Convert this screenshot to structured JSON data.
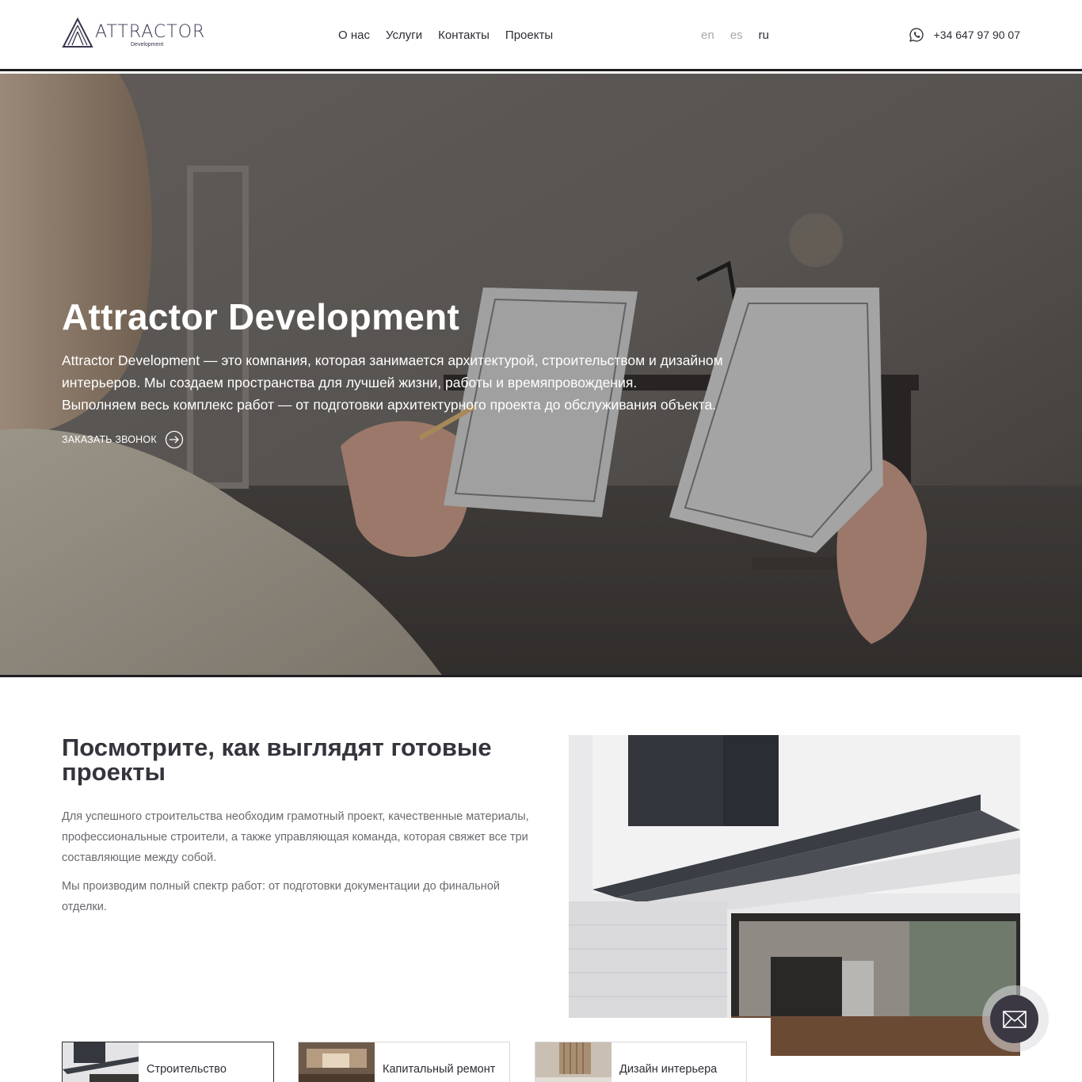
{
  "header": {
    "logo_text": "ATTRACTOR",
    "logo_sub": "Development",
    "nav": [
      "О нас",
      "Услуги",
      "Контакты",
      "Проекты"
    ],
    "langs": [
      {
        "code": "en",
        "active": false
      },
      {
        "code": "es",
        "active": false
      },
      {
        "code": "ru",
        "active": true
      }
    ],
    "phone": "+34 647 97 90 07",
    "phone_icon": "whatsapp-icon"
  },
  "hero": {
    "title": "Attractor Development",
    "lines": [
      "Attractor Development — это компания, которая занимается архитектурой, строительством и дизайном",
      "интерьеров. Мы создаем пространства для лучшей жизни, работы и времяпровождения.",
      "Выполняем весь комплекс работ — от подготовки архитектурного проекта до обслуживания объекта."
    ],
    "cta": "Заказать звонок",
    "cta_icon": "arrow-right-circle-icon"
  },
  "projects": {
    "title": "Посмотрите, как выглядят готовые проекты",
    "p1": "Для успешного строительства необходим грамотный проект, качественные материалы, профессиональные строители, а также управляющая команда, которая свяжет все три составляющие между собой.",
    "p2": "Мы производим полный спектр работ: от подготовки документации до финальной отделки."
  },
  "cards": [
    {
      "label": "Строительство",
      "active": true
    },
    {
      "label": "Капитальный ремонт",
      "active": false
    },
    {
      "label": "Дизайн интерьера",
      "active": false
    }
  ],
  "floating": {
    "icon": "mail-icon"
  },
  "colors": {
    "accent": "#3b3844",
    "text": "#2c2c34",
    "muted": "#6a6a70",
    "lang_inactive": "#a8a8ad"
  }
}
